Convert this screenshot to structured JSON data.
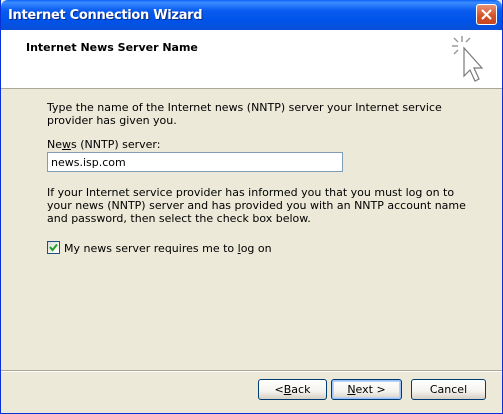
{
  "window": {
    "title": "Internet Connection Wizard"
  },
  "header": {
    "title": "Internet News Server Name"
  },
  "content": {
    "intro_text": "Type the name of the Internet news (NNTP) server your Internet service provider has given you.",
    "field_label_prefix": "Ne",
    "field_label_mnemonic": "w",
    "field_label_suffix": "s (NNTP) server:",
    "server_value": "news.isp.com",
    "info_text": "If your Internet service provider has informed you that you must log on to your news (NNTP) server and has provided you with an NNTP account name and password, then select the check box below.",
    "checkbox_checked": true,
    "checkbox_label_prefix": "My news server requires me to ",
    "checkbox_label_mnemonic": "l",
    "checkbox_label_suffix": "og on"
  },
  "buttons": {
    "back_prefix": "< ",
    "back_mnemonic": "B",
    "back_suffix": "ack",
    "next_mnemonic": "N",
    "next_suffix": "ext >",
    "cancel": "Cancel"
  },
  "colors": {
    "titlebar": "#0053e8",
    "dialog_bg": "#ece9d8",
    "header_bg": "#ffffff",
    "accent_border": "#003c74"
  }
}
